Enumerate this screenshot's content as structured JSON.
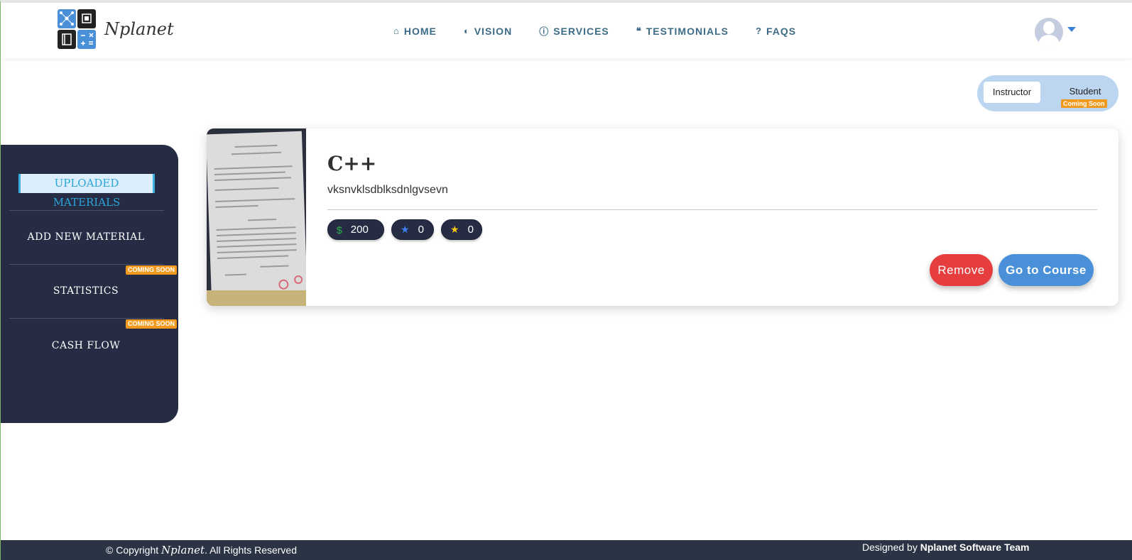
{
  "header": {
    "brand": "Nplanet",
    "logo_tile_text": "− ×\n+ =",
    "nav": [
      {
        "icon": "home-icon",
        "glyph": "⌂",
        "label": "HOME"
      },
      {
        "icon": "brain-icon",
        "glyph": "◐",
        "label": "VISION"
      },
      {
        "icon": "info-icon",
        "glyph": "ⓘ",
        "label": "SERVICES"
      },
      {
        "icon": "quote-icon",
        "glyph": "❝",
        "label": "TESTIMONIALS"
      },
      {
        "icon": "question-icon",
        "glyph": "?",
        "label": "FAQS"
      }
    ]
  },
  "role_toggle": {
    "instructor": "Instructor",
    "student": "Student",
    "student_badge": "Coming Soon"
  },
  "sidebar": {
    "items": [
      {
        "label": "UPLOADED MATERIALS",
        "active": true
      },
      {
        "label": "ADD NEW MATERIAL"
      },
      {
        "label": "STATISTICS",
        "badge": "COMING SOON"
      },
      {
        "label": "CASH FLOW",
        "badge": "COMING SOON"
      }
    ]
  },
  "course": {
    "title": "C++",
    "description": "vksnvklsdblksdnlgvsevn",
    "price_symbol": "$",
    "price": "200",
    "rating_blue": "0",
    "rating_gold": "0",
    "remove_label": "Remove",
    "go_label": "Go to Course"
  },
  "footer": {
    "copyright_prefix": "© Copyright ",
    "copyright_brand": "Nplanet",
    "copyright_suffix": ". All Rights Reserved",
    "designed_prefix": "Designed by ",
    "designed_team": "Nplanet Software Team"
  },
  "colors": {
    "accent": "#4a90d9",
    "sidebar": "#252c44",
    "danger": "#e63e3e",
    "badge": "#f39a1e"
  }
}
